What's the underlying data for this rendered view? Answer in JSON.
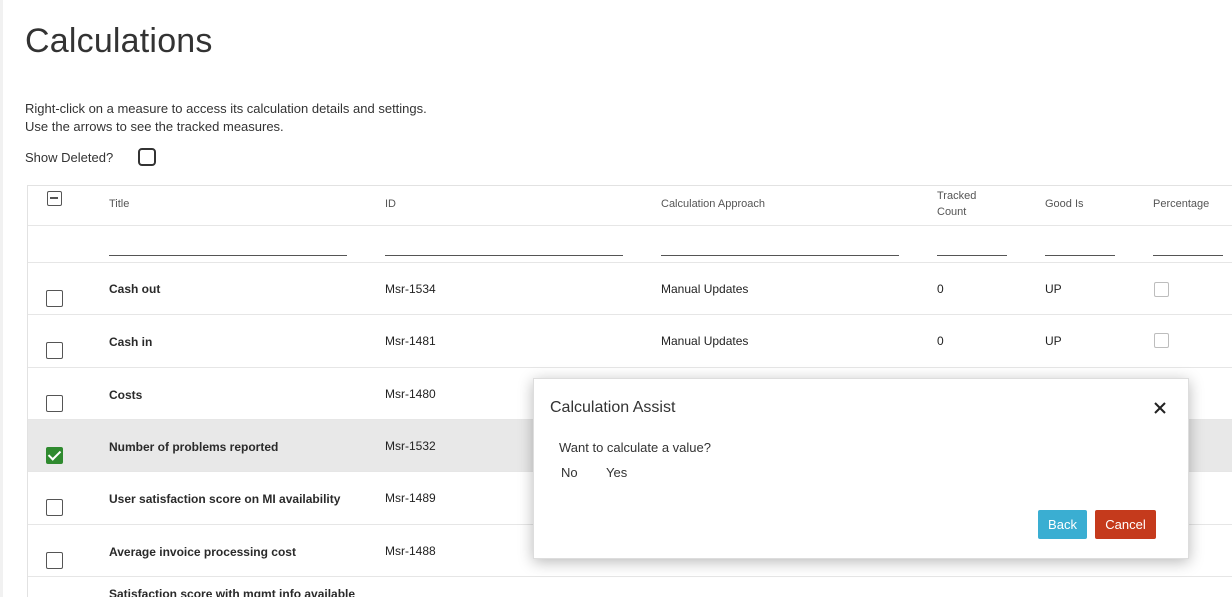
{
  "page": {
    "title": "Calculations",
    "instruction_line1": "Right-click on a measure to access its calculation details and settings.",
    "instruction_line2": "Use the arrows to see the tracked measures.",
    "show_deleted_label": "Show Deleted?"
  },
  "grid": {
    "columns": {
      "title": "Title",
      "id": "ID",
      "approach": "Calculation Approach",
      "tracked_line1": "Tracked",
      "tracked_line2": "Count",
      "good_is": "Good Is",
      "percentage": "Percentage"
    },
    "rows": [
      {
        "title": "Cash out",
        "id": "Msr-1534",
        "approach": "Manual Updates",
        "tracked": "0",
        "good_is": "UP",
        "checked": false
      },
      {
        "title": "Cash in",
        "id": "Msr-1481",
        "approach": "Manual Updates",
        "tracked": "0",
        "good_is": "UP",
        "checked": false
      },
      {
        "title": "Costs",
        "id": "Msr-1480",
        "checked": false
      },
      {
        "title": "Number of problems reported",
        "id": "Msr-1532",
        "checked": true
      },
      {
        "title": "User satisfaction score on MI availability",
        "id": "Msr-1489",
        "checked": false
      },
      {
        "title": "Average invoice processing cost",
        "id": "Msr-1488",
        "checked": false
      },
      {
        "title": "Satisfaction score with mgmt info available",
        "checked": false
      }
    ]
  },
  "dialog": {
    "title": "Calculation Assist",
    "question": "Want to calculate a value?",
    "option_no": "No",
    "option_yes": "Yes",
    "back_label": "Back",
    "cancel_label": "Cancel"
  },
  "colors": {
    "checked_green": "#2f8a2f",
    "back_button": "#3aaed2",
    "cancel_button": "#c53a1c",
    "selected_row": "#e8e8e8"
  },
  "icons": [
    "checkbox-icon",
    "checkmark-icon",
    "close-icon",
    "minus-icon"
  ]
}
